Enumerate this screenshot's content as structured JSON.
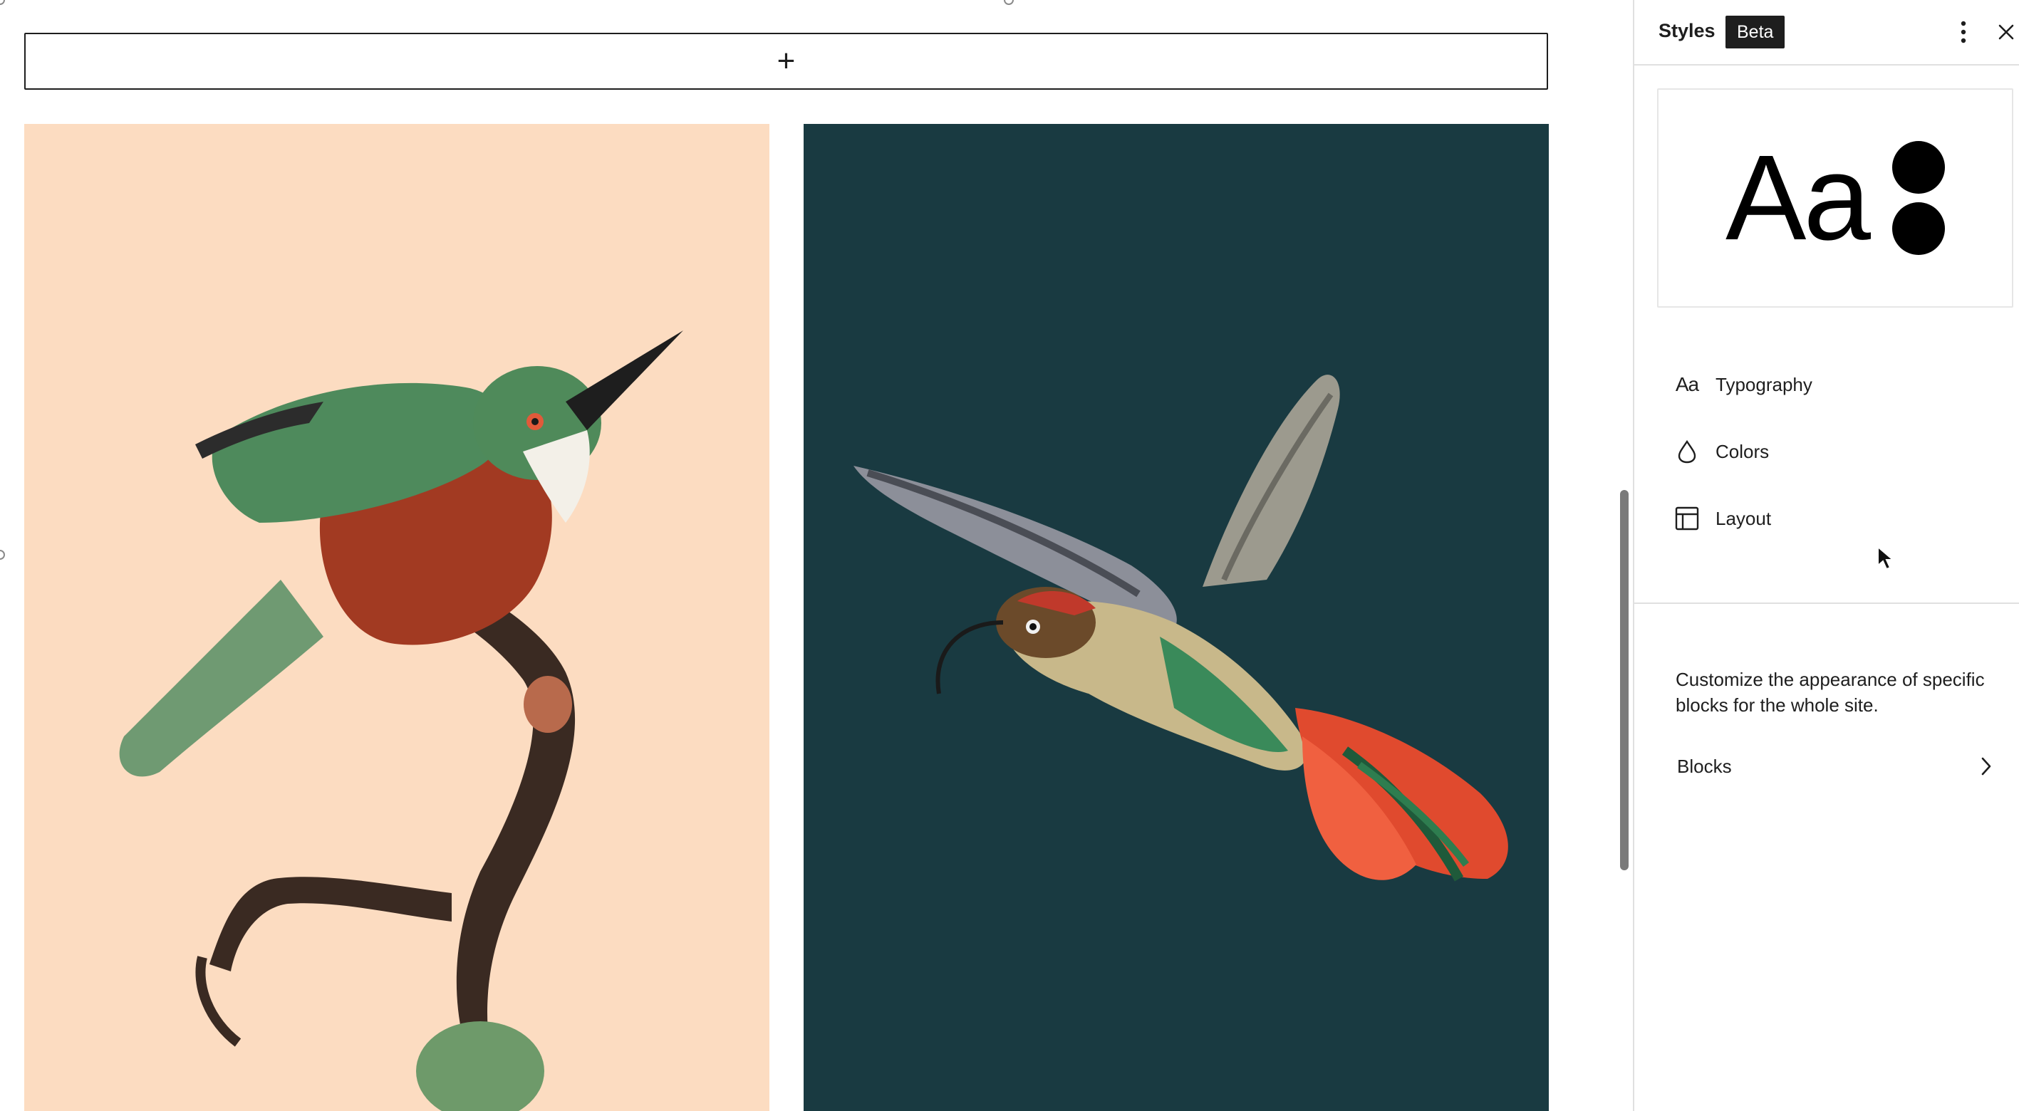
{
  "canvas": {
    "inserter_symbol": "+",
    "images": [
      {
        "name": "kingfisher-on-branch",
        "background": "#fcdcc1"
      },
      {
        "name": "hummingbird-in-flight",
        "background": "#193a41"
      }
    ]
  },
  "sidebar": {
    "title": "Styles",
    "badge": "Beta",
    "more_icon": "more-vertical-icon",
    "close_icon": "close-icon",
    "preview": {
      "text": "Aa"
    },
    "nav": [
      {
        "label": "Typography",
        "icon": "typography-icon",
        "icon_text": "Aa"
      },
      {
        "label": "Colors",
        "icon": "droplet-icon"
      },
      {
        "label": "Layout",
        "icon": "layout-icon"
      }
    ],
    "description": "Customize the appearance of specific blocks for the whole site.",
    "blocks": {
      "label": "Blocks",
      "icon": "chevron-right-icon"
    }
  },
  "colors": {
    "text": "#1e1e1e",
    "border": "#e0e0e0",
    "left_image_bg": "#fcdcc1",
    "right_image_bg": "#193a41"
  }
}
